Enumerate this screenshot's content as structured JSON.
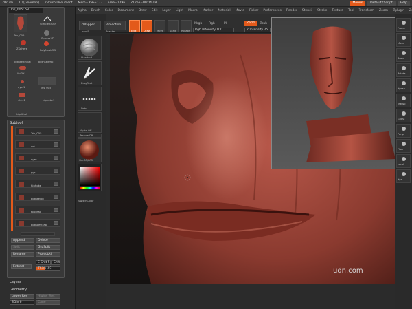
{
  "titlebar": {
    "app": "ZBrush",
    "version": "1.1[Gnomon]",
    "document": "ZBrush Document",
    "stats_mem": "Mem=356+177",
    "stats_free": "Free=1796",
    "stats_time": "ZTime=00:04:48",
    "menus_label": "Menus",
    "default_script": "DefaultZScript",
    "help_label": "Help"
  },
  "menubar": [
    "Alpha",
    "Brush",
    "Color",
    "Document",
    "Draw",
    "Edit",
    "Layer",
    "Light",
    "Macro",
    "Marker",
    "Material",
    "Movie",
    "Picker",
    "Preferences",
    "Render",
    "Stencil",
    "Stroke",
    "Texture",
    "Tool",
    "Transform",
    "Zoom",
    "Zplugin",
    "Zscript"
  ],
  "tool": {
    "title": "Tris_005: 58",
    "items": [
      {
        "label": "Tris_005"
      },
      {
        "label": "SimpleBrush"
      },
      {
        "label": "ZSphere"
      },
      {
        "label": "Sphere3D"
      },
      {
        "label": "PolyMesh3D"
      },
      {
        "label": "bothseltinkat"
      },
      {
        "label": "bothseltrsp"
      },
      {
        "label": "lipl3d1"
      },
      {
        "label": "eyel1"
      },
      {
        "label": "Tris_005"
      },
      {
        "label": "shirt1"
      },
      {
        "label": "hiphoke1"
      },
      {
        "label": "hipilthat"
      }
    ]
  },
  "subtool": {
    "title": "Subtool",
    "rows": [
      "Tris_005",
      "cot",
      "eyes",
      "pgr",
      "hiphoke",
      "bothselbo",
      "topdrap",
      "bothoestrap"
    ],
    "append": "Append",
    "delete": "Delete",
    "split": "Split",
    "grpsplit": "GrpSplit",
    "rename": "Rename",
    "projectall": "ProjectAll",
    "extract": "Extract",
    "esmt": "E Smt 5",
    "smt": "Smt",
    "thick": "Thick .03",
    "thick_level": 0.35,
    "layers": "Layers",
    "geometry": "Geometry",
    "lower_res": "Lower Res",
    "higher_res": "Higher Res",
    "sdiv": "SDiv 6",
    "cage": "Cage"
  },
  "shelf": {
    "standard": "Standard",
    "dragrect": "DragRect",
    "dots": "Dots",
    "alpha_off": "Alpha Off",
    "texture_off": "Texture Off",
    "material": "Skin05/BPR",
    "switchcolor": "SwitchColor"
  },
  "topbar": {
    "zmapper": "ZMapper",
    "zmapper_sub": "rev-E",
    "projection": "Projection",
    "projection_sub": "Master",
    "edit": "Edit",
    "draw": "Draw",
    "move": "Move",
    "scale": "Scale",
    "rotate": "Rotate",
    "mrgb": "Mrgb",
    "rgb": "Rgb",
    "m": "M",
    "rgb_intensity": "Rgb Intensity 100",
    "zadd": "Zadd",
    "zsub": "Zsub",
    "z_intensity": "Z Intensity 25"
  },
  "rightshelf": [
    "Frame",
    "Move",
    "Scale",
    "Rotate",
    "Xpose",
    "Transp",
    "Ghost",
    "Persp",
    "Floor",
    "Local",
    "Xyz"
  ],
  "watermark": "udn.com"
}
